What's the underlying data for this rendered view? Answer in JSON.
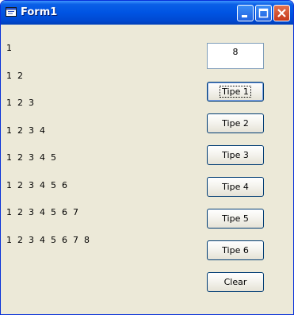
{
  "window": {
    "title": "Form1",
    "icon": "form-icon",
    "controls": [
      "minimize-icon",
      "maximize-icon",
      "close-icon"
    ],
    "colors": {
      "titlebar": "#0054e3",
      "client": "#ece9d8",
      "close": "#c6391b"
    }
  },
  "output": {
    "lines": [
      "1",
      "1  2",
      "1  2  3",
      "1  2  3  4",
      "1  2  3  4  5",
      "1  2  3  4  5  6",
      "1  2  3  4  5  6  7",
      "1  2  3  4  5  6  7  8"
    ]
  },
  "input": {
    "value": "8"
  },
  "buttons": {
    "tipe1": "Tipe 1",
    "tipe2": "Tipe 2",
    "tipe3": "Tipe 3",
    "tipe4": "Tipe 4",
    "tipe5": "Tipe 5",
    "tipe6": "Tipe  6",
    "clear": "Clear"
  }
}
